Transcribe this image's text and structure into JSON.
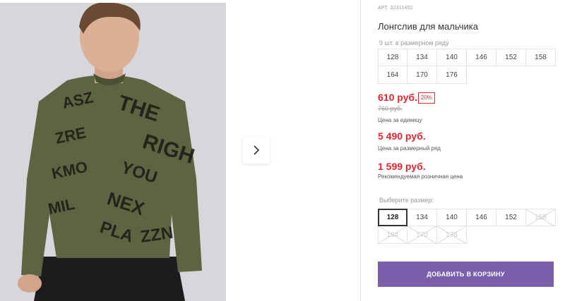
{
  "product": {
    "article": "АРТ. 32311452",
    "title": "Лонгслив для мальчика",
    "row_count_text": "9 шт. в размерном ряду",
    "row_sizes": [
      "128",
      "134",
      "140",
      "146",
      "152",
      "158",
      "164",
      "170",
      "176"
    ]
  },
  "pricing": {
    "unit_price": "610 руб.",
    "discount": "20%",
    "old_price": "760 руб.",
    "unit_label": "Цена за единицу",
    "row_price": "5 490 руб.",
    "row_label": "Цена за размерный ряд",
    "retail_price": "1 599 руб.",
    "retail_label": "Рекомендуемая розничная цена"
  },
  "size_picker": {
    "label": "Выберите размер:",
    "sizes": [
      {
        "size": "128",
        "state": "selected"
      },
      {
        "size": "134",
        "state": "available"
      },
      {
        "size": "140",
        "state": "available"
      },
      {
        "size": "146",
        "state": "available"
      },
      {
        "size": "152",
        "state": "available"
      },
      {
        "size": "158",
        "state": "disabled"
      },
      {
        "size": "164",
        "state": "disabled"
      },
      {
        "size": "170",
        "state": "disabled"
      },
      {
        "size": "176",
        "state": "disabled"
      }
    ]
  },
  "cart": {
    "add_label": "ДОБАВИТЬ В КОРЗИНУ"
  },
  "colors": {
    "accent": "#7b5fad",
    "price": "#e3262f",
    "shirt": "#5d6441"
  },
  "icons": {
    "gallery_next": "chevron-right-icon"
  }
}
